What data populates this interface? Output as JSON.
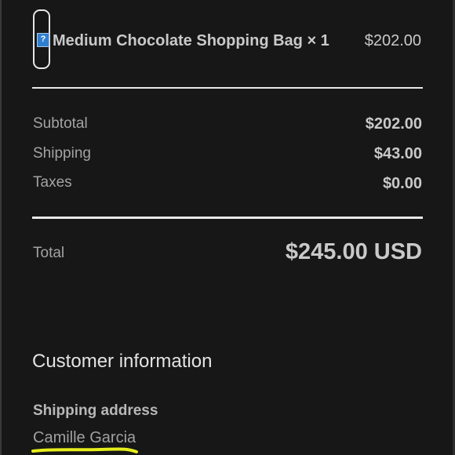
{
  "order_item": {
    "name": "Medium Chocolate Shopping Bag × 1",
    "price": "$202.00",
    "thumbnail_icon": "broken-image-icon"
  },
  "summary": {
    "subtotal_label": "Subtotal",
    "subtotal_value": "$202.00",
    "shipping_label": "Shipping",
    "shipping_value": "$43.00",
    "taxes_label": "Taxes",
    "taxes_value": "$0.00",
    "total_label": "Total",
    "total_value": "$245.00 USD"
  },
  "customer": {
    "section_title": "Customer information",
    "shipping_address_label": "Shipping address",
    "name": "Camille Garcia"
  },
  "colors": {
    "background": "#171717",
    "highlight": "#e6ee1c"
  }
}
